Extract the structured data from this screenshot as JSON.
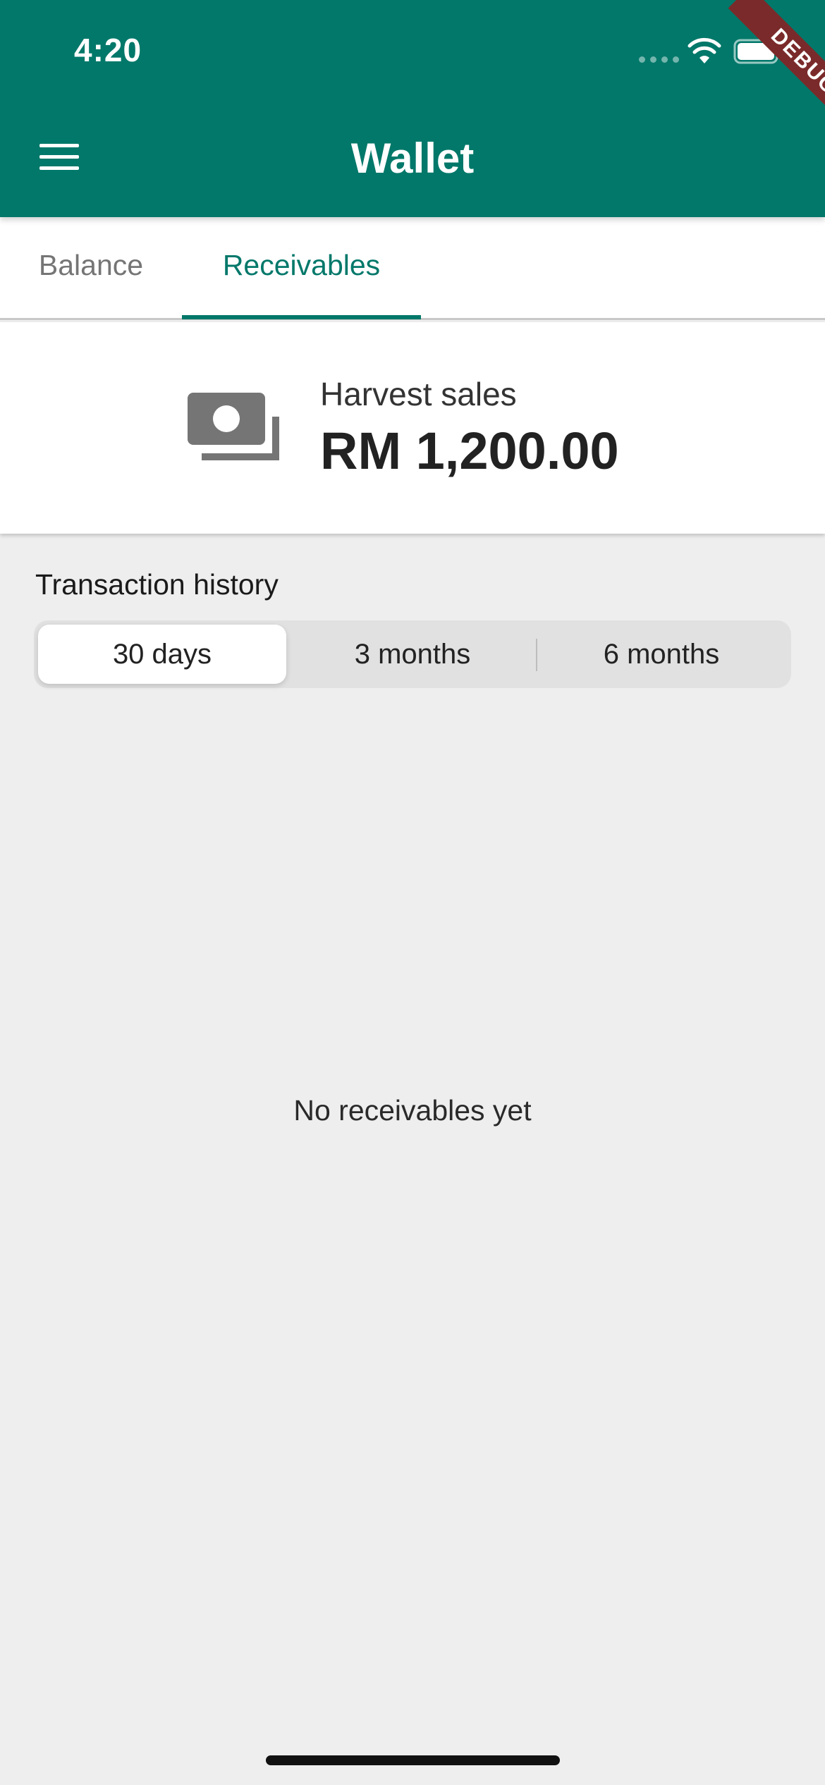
{
  "status_bar": {
    "time": "4:20",
    "icons": [
      "signal-icon",
      "wifi-icon",
      "battery-icon"
    ]
  },
  "app_bar": {
    "title": "Wallet",
    "menu_icon": "menu-icon",
    "background_color": "#02786a"
  },
  "debug_banner": {
    "label": "DEBUG",
    "color": "#7a2a2a"
  },
  "tabs": [
    {
      "label": "Balance",
      "selected": false
    },
    {
      "label": "Receivables",
      "selected": true
    }
  ],
  "summary": {
    "icon": "money-icon",
    "label": "Harvest sales",
    "amount": "RM 1,200.00"
  },
  "history": {
    "title": "Transaction history",
    "periods": [
      {
        "label": "30 days",
        "selected": true
      },
      {
        "label": "3 months",
        "selected": false
      },
      {
        "label": "6 months",
        "selected": false
      }
    ],
    "empty_message": "No receivables yet"
  },
  "colors": {
    "accent": "#02786a",
    "background": "#eeeeee",
    "surface": "#ffffff"
  }
}
